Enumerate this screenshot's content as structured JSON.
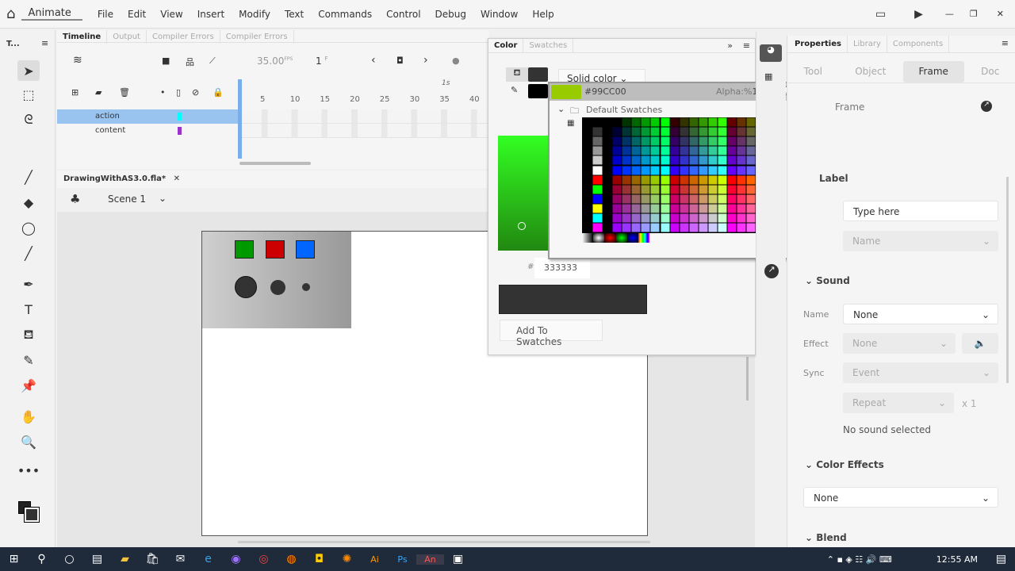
{
  "app": {
    "name": "Animate",
    "menu": [
      "File",
      "Edit",
      "View",
      "Insert",
      "Modify",
      "Text",
      "Commands",
      "Control",
      "Debug",
      "Window",
      "Help"
    ]
  },
  "tools_panel": {
    "title": "T..."
  },
  "timeline": {
    "tabs": [
      "Timeline",
      "Output",
      "Compiler Errors",
      "Compiler Errors"
    ],
    "fps": "35.00",
    "fps_unit": "FPS",
    "frame": "1",
    "frame_unit": "F",
    "ruler": [
      "5",
      "10",
      "15",
      "20",
      "25",
      "30",
      "35",
      "40"
    ],
    "second_marker": "1s",
    "layers": [
      {
        "name": "action",
        "color": "#00ffff",
        "selected": true
      },
      {
        "name": "content",
        "color": "#9933cc",
        "selected": false
      }
    ]
  },
  "document": {
    "tab": "DrawingWithAS3.0.fla*",
    "scene": "Scene 1"
  },
  "stage": {
    "squares": [
      "#009900",
      "#cc0000",
      "#0066ff"
    ]
  },
  "color_panel": {
    "tabs": [
      "Color",
      "Swatches"
    ],
    "fill_type": "Solid color",
    "hex_label": "#",
    "hex": "333333",
    "preview_color": "#333333",
    "add_button": "Add To Swatches"
  },
  "swatch_popup": {
    "hex": "#99CC00",
    "swatch_color": "#99cc00",
    "alpha_label": "Alpha:%",
    "alpha": "100",
    "folder": "Default Swatches"
  },
  "properties": {
    "tabs": [
      "Properties",
      "Library",
      "Components"
    ],
    "subtabs": [
      "Tool",
      "Object",
      "Frame",
      "Doc"
    ],
    "active_subtab": "Frame",
    "header": "Frame",
    "label_section": "Label",
    "label_name_placeholder": "Type here",
    "label_type": "Name",
    "sound_section": "Sound",
    "sound_name_label": "Name",
    "sound_name": "None",
    "effect_label": "Effect",
    "effect": "None",
    "sync_label": "Sync",
    "sync": "Event",
    "repeat": "Repeat",
    "repeat_count": "x 1",
    "sound_status": "No sound selected",
    "color_effects_section": "Color Effects",
    "color_effect": "None",
    "blend_section": "Blend"
  },
  "taskbar": {
    "time": "12:55 AM"
  }
}
